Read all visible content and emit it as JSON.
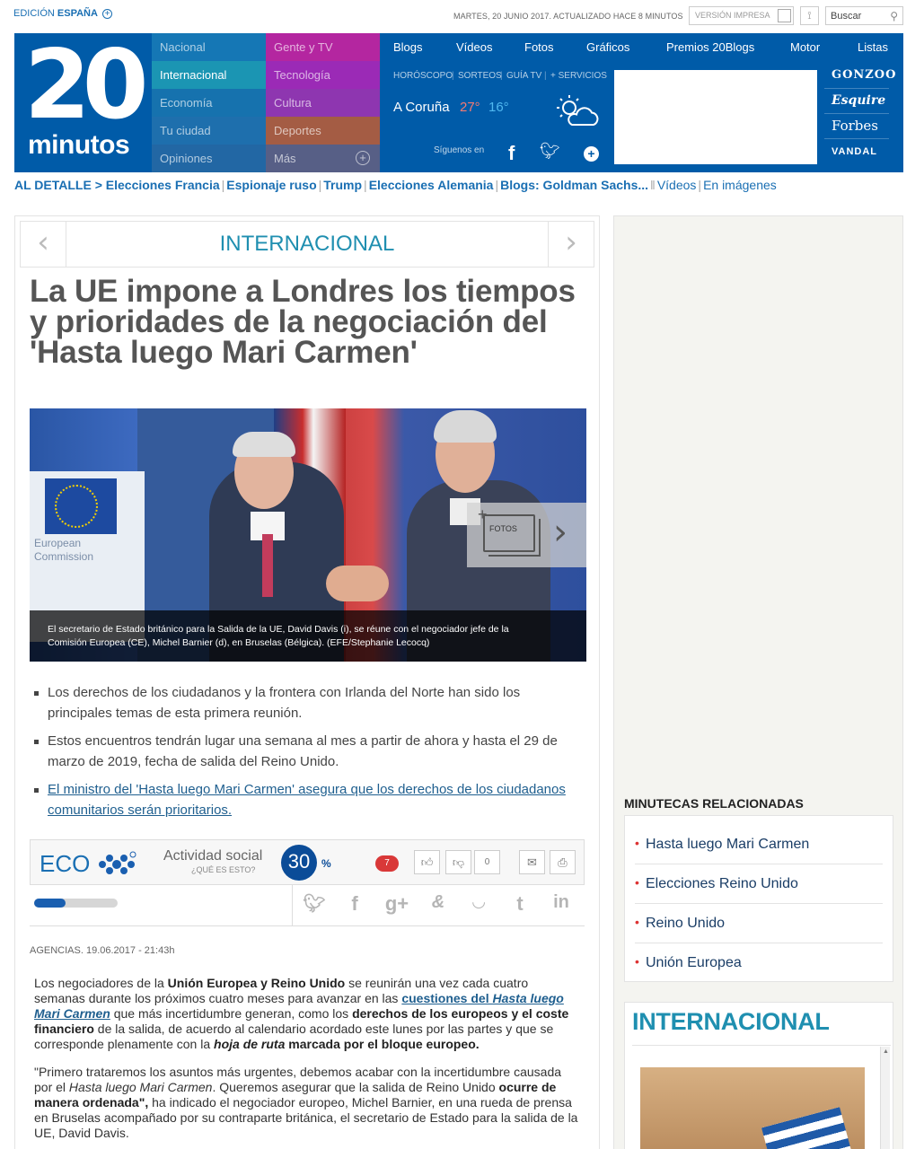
{
  "topbar": {
    "edition_prefix": "EDICIÓN",
    "edition_region": "ESPAÑA",
    "edition_toggle_icon": "plus-circle-icon",
    "date_text": "MARTES, 20 JUNIO 2017. ACTUALIZADO HACE 8 MINUTOS",
    "print_label": "VERSIÓN IMPRESA",
    "print_icon": "document-icon",
    "rss_icon": "rss-icon",
    "search_label": "Buscar",
    "search_icon": "magnifier-icon"
  },
  "logo": {
    "number": "20",
    "word": "minutos"
  },
  "sections": [
    {
      "label": "Nacional",
      "color": "#1577b5"
    },
    {
      "label": "Internacional",
      "color": "#1b95b3",
      "active": true
    },
    {
      "label": "Economía",
      "color": "#1672ae"
    },
    {
      "label": "Tu ciudad",
      "color": "#1e6fad"
    },
    {
      "label": "Opiniones",
      "color": "#2267a4"
    },
    {
      "label": "Gente y TV",
      "color": "#b426a0"
    },
    {
      "label": "Tecnología",
      "color": "#9b2ab6"
    },
    {
      "label": "Cultura",
      "color": "#8e36b0"
    },
    {
      "label": "Deportes",
      "color": "#a45c44"
    },
    {
      "label": "Más",
      "color": "#575f86"
    }
  ],
  "topnav": [
    "Blogs",
    "Vídeos",
    "Fotos",
    "Gráficos",
    "Premios 20Blogs",
    "Motor",
    "Listas"
  ],
  "subnav": [
    "HORÓSCOPO",
    "SORTEOS",
    "GUÍA TV",
    "+ SERVICIOS"
  ],
  "weather": {
    "city": "A Coruña",
    "max": "27°",
    "min": "16°",
    "icon": "partly-cloudy-icon"
  },
  "follow": {
    "label": "Síguenos en"
  },
  "brands": [
    "GONZOO",
    "Esquire",
    "Forbes",
    "VANDAL"
  ],
  "al_detalle": {
    "prefix": "AL DETALLE >",
    "topics": [
      "Elecciones Francia",
      "Espionaje ruso",
      "Trump",
      "Elecciones Alemania",
      "Blogs: Goldman Sachs..."
    ],
    "media": [
      "Vídeos",
      "En imágenes"
    ]
  },
  "article": {
    "section": "INTERNACIONAL",
    "headline": "La UE impone a Londres los tiempos y prioridades de la negociación del 'Hasta luego Mari Carmen'",
    "photo": {
      "ec_line1": "European",
      "ec_line2": "Commission",
      "fotos_label": "FOTOS",
      "caption": "El secretario de Estado británico para la Salida de la UE, David Davis (i), se réune con el negociador jefe de la Comisión Europea (CE), Michel Barnier (d), en Bruselas (Bélgica). (EFE/Stephanie Lecocq)"
    },
    "bullets": [
      "Los derechos de los ciudadanos y la frontera con Irlanda del Norte han sido los principales temas de esta primera reunión.",
      "Estos encuentros tendrán lugar una semana al mes a partir de ahora y hasta el 29 de marzo de 2019, fecha de salida del Reino Unido.",
      "El ministro del 'Hasta luego Mari Carmen' asegura que los derechos de los ciudadanos comunitarios serán prioritarios."
    ],
    "eco": {
      "label": "ECO",
      "activity_label": "Actividad social",
      "activity_question": "¿QUÉ ES ESTO?",
      "score": "30",
      "score_unit": "%",
      "comments": "7",
      "votes": "0",
      "social_progress": 0.3
    },
    "byline": "AGENCIAS. 19.06.2017 - 21:43h",
    "paragraphs": {
      "p1_a": "Los negociadores de la ",
      "p1_b": "Unión Europea y Reino Unido",
      "p1_c": " se reunirán una vez cada cuatro semanas durante los próximos cuatro meses para avanzar en las ",
      "p1_link1": "cuestiones del ",
      "p1_link2": "Hasta luego Mari Carmen",
      "p1_d": " que más incertidumbre generan, como los ",
      "p1_e": "derechos de los europeos y el coste financiero",
      "p1_f": " de la salida, de acuerdo al calendario acordado este lunes por las partes y que se corresponde plenamente con la ",
      "p1_g": "hoja de ruta",
      "p1_h": " marcada por el bloque europeo.",
      "p2_a": "\"Primero trataremos los asuntos más urgentes, debemos acabar con la incertidumbre causada por el ",
      "p2_b": "Hasta luego Mari Carmen",
      "p2_c": ". Queremos asegurar que la salida de Reino Unido ",
      "p2_d": "ocurre de manera ordenada\",",
      "p2_e": " ha indicado el negociador europeo, Michel Barnier, en una rueda de prensa en Bruselas acompañado por su contraparte británica, el secretario de Estado para la salida de la UE, David Davis."
    }
  },
  "sidebar": {
    "minutecas_title": "MINUTECAS RELACIONADAS",
    "minutecas": [
      "Hasta luego Mari Carmen",
      "Elecciones Reino Unido",
      "Reino Unido",
      "Unión Europea"
    ],
    "section_box_title": "INTERNACIONAL"
  }
}
